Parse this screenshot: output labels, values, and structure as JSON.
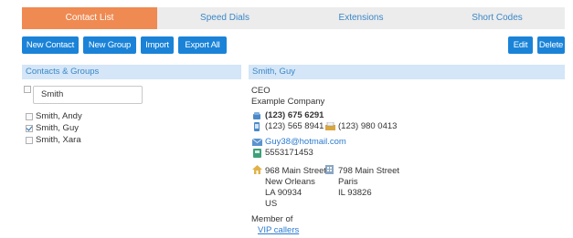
{
  "tabs": [
    {
      "label": "Contact List",
      "active": true
    },
    {
      "label": "Speed Dials",
      "active": false
    },
    {
      "label": "Extensions",
      "active": false
    },
    {
      "label": "Short Codes",
      "active": false
    }
  ],
  "toolbar": {
    "new_contact": "New Contact",
    "new_group": "New Group",
    "import": "Import",
    "export_all": "Export All",
    "edit": "Edit",
    "delete": "Delete"
  },
  "left_panel": {
    "title": "Contacts & Groups",
    "search_value": "Smith",
    "contacts": [
      {
        "name": "Smith, Andy",
        "checked": false
      },
      {
        "name": "Smith, Guy",
        "checked": true
      },
      {
        "name": "Smith, Xara",
        "checked": false
      }
    ]
  },
  "right_panel": {
    "title": "Smith, Guy",
    "job_title": "CEO",
    "company": "Example Company",
    "phone_main": "(123) 675 6291",
    "phone_mobile": "(123) 565 8941",
    "phone_fax": "(123) 980 0413",
    "email": "Guy38@hotmail.com",
    "pager": "5553171453",
    "home_address": {
      "street": "968 Main Street",
      "city": "New Orleans",
      "region": "LA 90934",
      "country": "US"
    },
    "work_address": {
      "street": "798 Main Street",
      "city": "Paris",
      "region": "IL 93826"
    },
    "member_of_label": "Member of",
    "group": "VIP callers"
  },
  "colors": {
    "accent_orange": "#ef8a52",
    "button_blue": "#1a83d8",
    "panel_header": "#d4e6f7",
    "link_blue": "#2b7bd0"
  }
}
